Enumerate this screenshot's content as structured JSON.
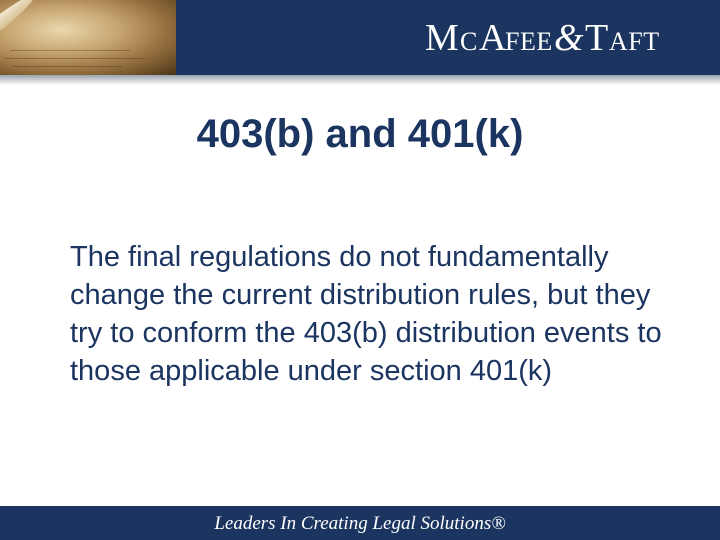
{
  "header": {
    "logo_text": "McAfee&Taft"
  },
  "slide": {
    "title": "403(b) and 401(k)",
    "body": "The final regulations do not fundamentally change the current distribution rules, but they try to conform the 403(b) distribution events to those applicable under section 401(k)"
  },
  "footer": {
    "tagline": "Leaders In Creating Legal Solutions®"
  },
  "colors": {
    "navy": "#1b3560",
    "white": "#ffffff"
  }
}
